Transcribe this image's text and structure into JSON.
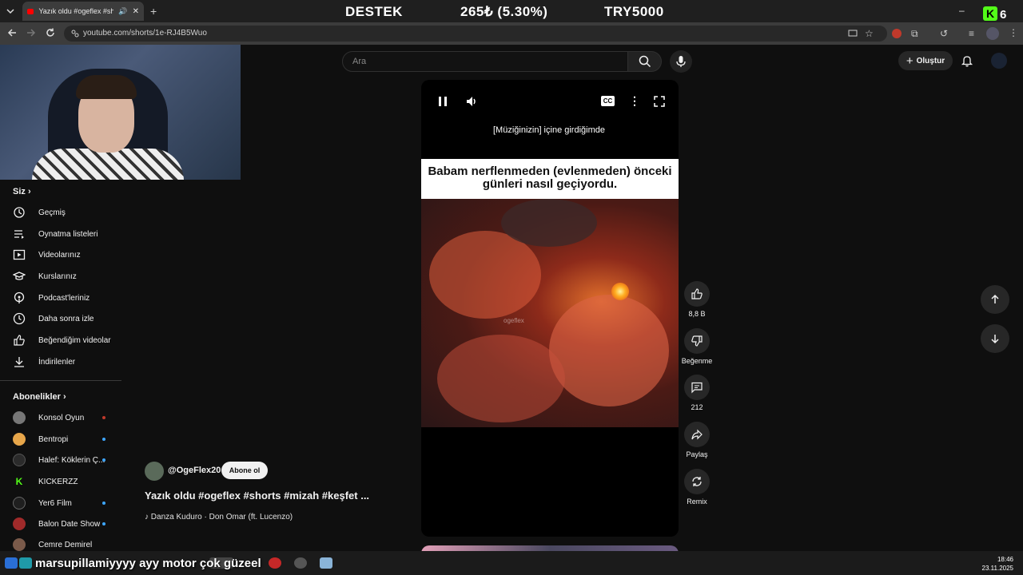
{
  "browser": {
    "tab_title": "Yazık oldu #ogeflex #shorts",
    "url": "youtube.com/shorts/1e-RJ4B5Wuo"
  },
  "stream_overlay": {
    "destek_label": "DESTEK",
    "amount": "265₺ (5.30%)",
    "goal": "TRY5000",
    "kick_count": "6"
  },
  "sidebar": {
    "you_heading": "Siz",
    "items": [
      {
        "label": "Geçmiş",
        "icon": "history-icon"
      },
      {
        "label": "Oynatma listeleri",
        "icon": "playlist-icon"
      },
      {
        "label": "Videolarınız",
        "icon": "your-videos-icon"
      },
      {
        "label": "Kurslarınız",
        "icon": "courses-icon"
      },
      {
        "label": "Podcast'leriniz",
        "icon": "podcast-icon"
      },
      {
        "label": "Daha sonra izle",
        "icon": "clock-icon"
      },
      {
        "label": "Beğendiğim videolar",
        "icon": "like-icon"
      },
      {
        "label": "İndirilenler",
        "icon": "download-icon"
      }
    ],
    "subs_heading": "Abonelikler",
    "subscriptions": [
      {
        "name": "Konsol Oyun",
        "color": "#777777"
      },
      {
        "name": "Bentropi",
        "color": "#e7a64a"
      },
      {
        "name": "Halef: Köklerin Ç...",
        "color": "#2b2b2b"
      },
      {
        "name": "KICKERZZ",
        "color": "#53fc18"
      },
      {
        "name": "Yer6 Film",
        "color": "#1f1f1f"
      },
      {
        "name": "Balon Date Show",
        "color": "#a02a2a"
      },
      {
        "name": "Cemre Demirel",
        "color": "#7a5a4a"
      }
    ]
  },
  "header": {
    "search_placeholder": "Ara",
    "create_label": "Oluştur"
  },
  "video": {
    "caption": "[Müziğinizin] içine girdiğimde",
    "meme_text": "Babam nerflenmeden (evlenmeden) önceki günleri nasıl geçiyordu.",
    "watermark": "ogeflex",
    "channel": "@OgeFlex20",
    "subscribe_label": "Abone ol",
    "title": "Yazık oldu #ogeflex #shorts #mizah #keşfet ...",
    "music": "Danza Kuduro · Don Omar (ft. Lucenzo)"
  },
  "actions": {
    "likes": "8,8 B",
    "dislike_label": "Beğenme",
    "comments": "212",
    "share_label": "Paylaş",
    "remix_label": "Remix"
  },
  "taskbar": {
    "chat_text": "marsupillamiyyyy ayy motor çok güzeel",
    "time": "18:46",
    "date": "23.11.2025"
  }
}
